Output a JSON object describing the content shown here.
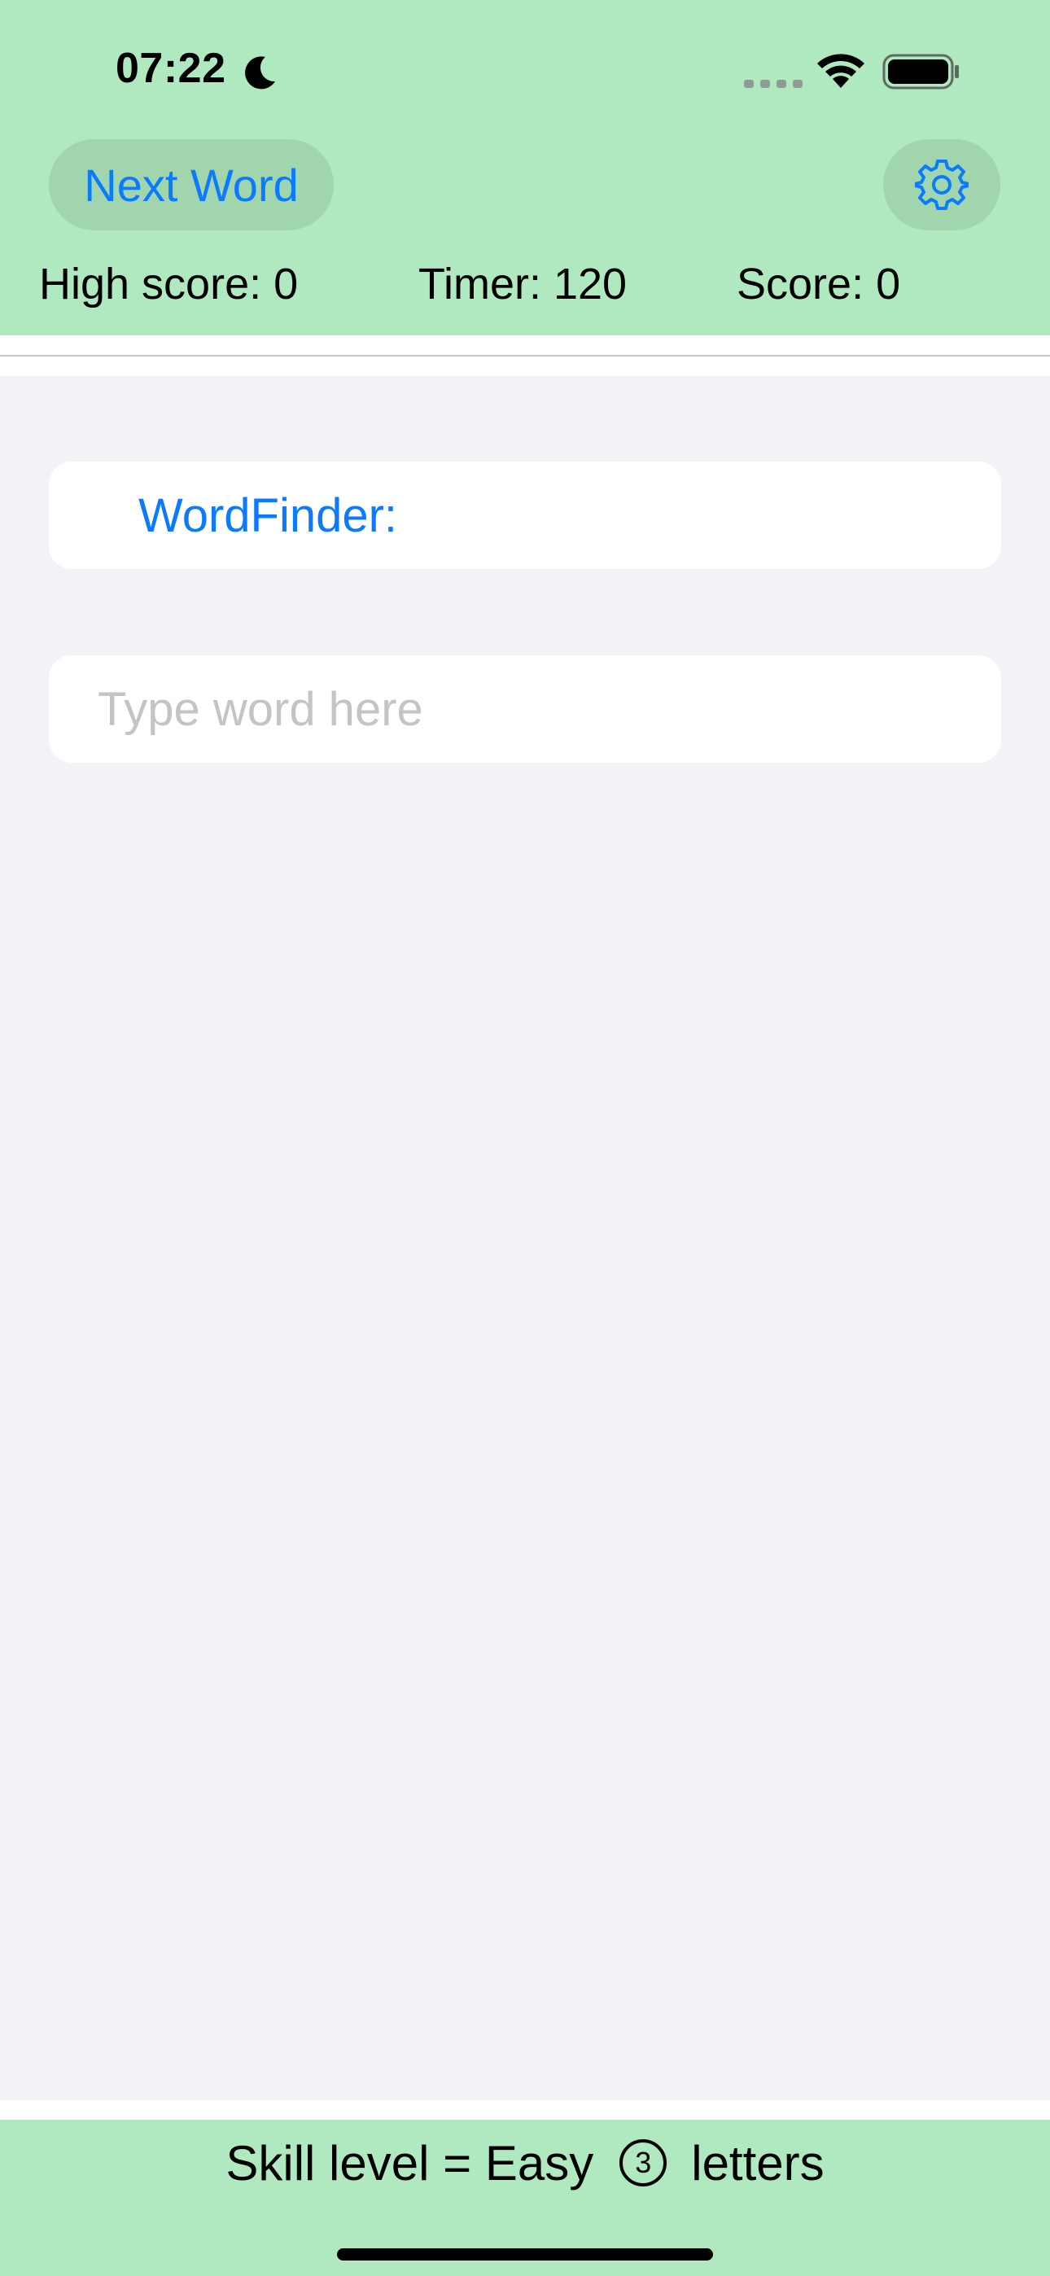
{
  "status_bar": {
    "time": "07:22",
    "icons": [
      "moon-icon",
      "cellular-signal-icon",
      "wifi-icon",
      "battery-icon"
    ]
  },
  "toolbar": {
    "next_word_label": "Next Word",
    "settings_icon": "gear-icon"
  },
  "stats": {
    "high_score": "High score: 0",
    "timer": "Timer: 120",
    "score": "Score: 0"
  },
  "main": {
    "title_label": "WordFinder:",
    "input_value": "",
    "input_placeholder": "Type word here"
  },
  "footer": {
    "skill_text": "Skill level = Easy",
    "letter_count": "3",
    "letters_text": "letters"
  },
  "colors": {
    "header_green": "#b0e8bf",
    "accent_blue": "#0a7aff",
    "background": "#f2f2f7"
  }
}
